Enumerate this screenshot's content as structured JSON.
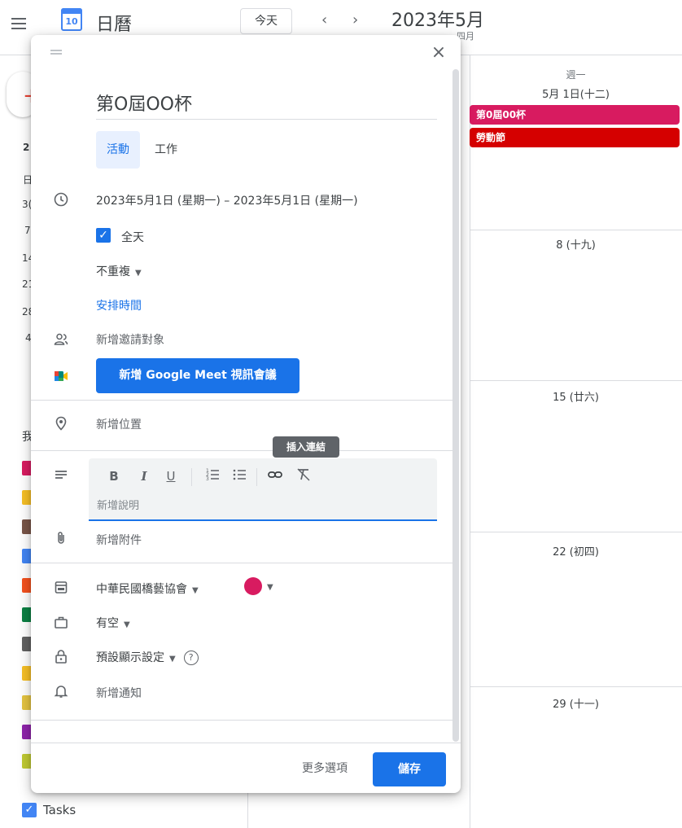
{
  "header": {
    "app_title": "日曆",
    "logo_day": "10",
    "today_label": "今天",
    "prev_arrow": "‹",
    "next_arrow": "›",
    "month_title": "2023年5月",
    "month_subtitle": "四月"
  },
  "sidebar": {
    "mini_fragments": [
      "2",
      "日",
      "3(",
      "7",
      "14",
      "21",
      "28",
      "4"
    ],
    "my_calendars_fragment": "我",
    "calendar_colors": [
      "#d81b60",
      "#f6bf26",
      "#795548",
      "#4285f4",
      "#f4511e",
      "#0b8043",
      "#616161",
      "#f6bf26",
      "#e4c441",
      "#8e24aa",
      "#c0ca33"
    ],
    "tasks_label": "Tasks"
  },
  "calendar_view": {
    "weekday": "週一",
    "first_date": "5月 1日(十二)",
    "events": [
      {
        "title": "第0屆00杯",
        "color": "#d81b60"
      },
      {
        "title": "勞動節",
        "color": "#d50000"
      }
    ],
    "day_labels": [
      "8 (十九)",
      "15 (廿六)",
      "22 (初四)",
      "29 (十一)"
    ]
  },
  "dialog": {
    "close_icon": "×",
    "title_value": "第O屆OO杯",
    "tabs": [
      "活動",
      "工作"
    ],
    "date_range": "2023年5月1日 (星期一)  –  2023年5月1日 (星期一)",
    "all_day_label": "全天",
    "all_day_checked": true,
    "repeat_label": "不重複",
    "find_time_label": "安排時間",
    "add_guests_placeholder": "新增邀請對象",
    "meet_button_label": "新增 Google Meet 視訊會議",
    "location_placeholder": "新增位置",
    "tooltip": "插入連結",
    "toolbar": {
      "bold": "B",
      "italic": "I",
      "underline": "U"
    },
    "description_placeholder": "新增說明",
    "attachment_placeholder": "新增附件",
    "calendar_name": "中華民國橋藝協會",
    "event_color": "#d81b60",
    "availability": "有空",
    "visibility": "預設顯示設定",
    "notification_placeholder": "新增通知",
    "more_options_label": "更多選項",
    "save_label": "儲存"
  }
}
